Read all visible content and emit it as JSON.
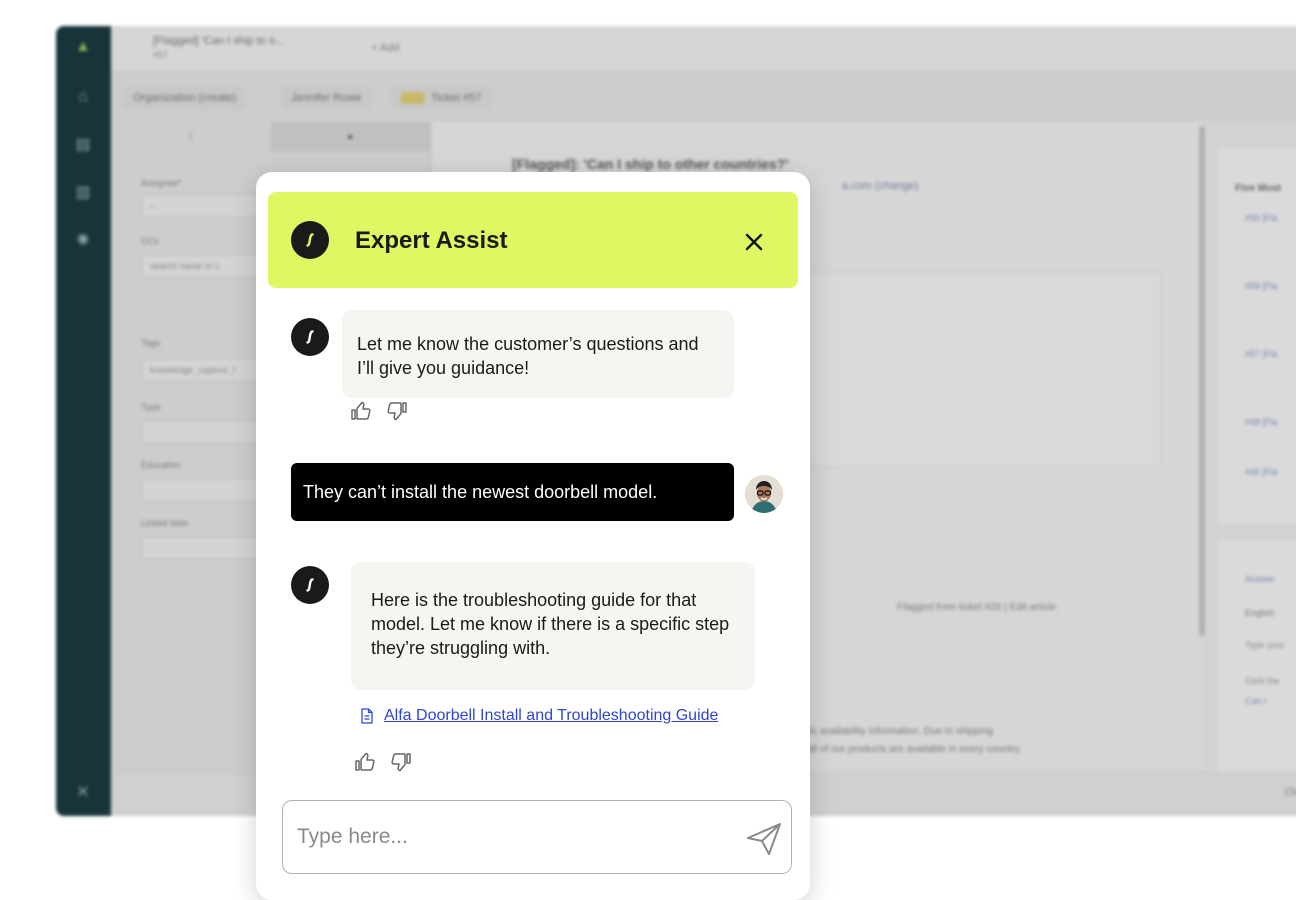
{
  "background_app": {
    "tab_title": "[Flagged] 'Can I ship to o...",
    "tab_subtitle": "#57",
    "tab_add_label": "+ Add",
    "breadcrumbs": [
      "Organization (create)",
      "Jennifer Rowe",
      "Ticket #57"
    ],
    "left_panel": {
      "labels": [
        "Assignee*",
        "CCs",
        "Tags",
        "Type",
        "Education",
        "Linked data"
      ],
      "cc_placeholder": "search name or c",
      "tags_value": "knowledge_capture_f",
      "type_value": "-"
    },
    "ticket_title": "[Flagged]: 'Can I ship to other countries?'",
    "ticket_sub": "a.com (change)",
    "flag_note": "Flagged from ticket #26 | Edit article",
    "article_text": [
      "fic availability information. Due to shipping",
      "all of our products are available in every country."
    ],
    "right_panel_title": "Five Most",
    "right_links": [
      "#56 [Fla",
      "#58 [Fla",
      "#57 [Fla",
      "#48 [Fla",
      "#46 [Fla"
    ],
    "right_sub": [
      "Answer",
      "English",
      "Type your",
      "Click the",
      "Can I"
    ],
    "bottom_label": "Close"
  },
  "assistant": {
    "title": "Expert Assist",
    "close_label": "Close",
    "messages": [
      {
        "from": "bot",
        "text": "Let me know the customer’s questions and I’ll give you guidance!"
      },
      {
        "from": "user",
        "text": "They can’t install the newest doorbell model."
      },
      {
        "from": "bot",
        "text": "Here is the troubleshooting guide for that model. Let me know if there is a specific step they’re struggling with."
      }
    ],
    "source_link": "Alfa Doorbell Install and Troubleshooting Guide",
    "input_placeholder": "Type here...",
    "colors": {
      "header_bg": "#ddf862",
      "bot_bubble": "#f6f5f1",
      "user_bubble": "#000000",
      "link": "#2f46d0"
    }
  }
}
